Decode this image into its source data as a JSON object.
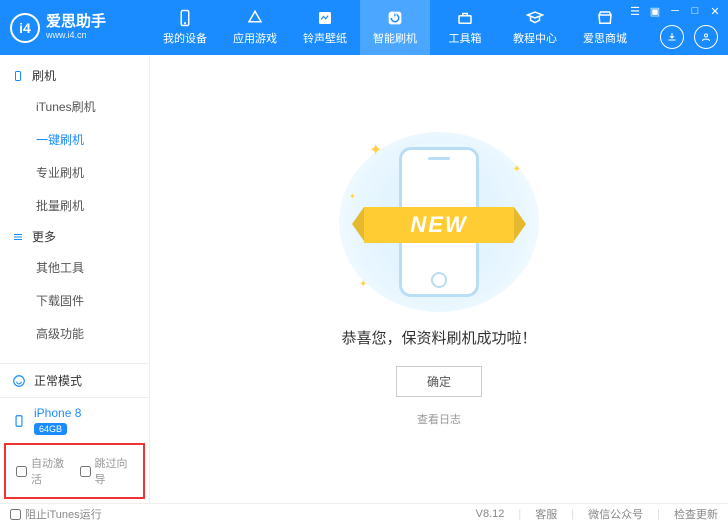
{
  "logo": {
    "badge": "i4",
    "title": "爱思助手",
    "url": "www.i4.cn"
  },
  "nav": [
    {
      "label": "我的设备"
    },
    {
      "label": "应用游戏"
    },
    {
      "label": "铃声壁纸"
    },
    {
      "label": "智能刷机"
    },
    {
      "label": "工具箱"
    },
    {
      "label": "教程中心"
    },
    {
      "label": "爱思商城"
    }
  ],
  "sidebar": {
    "section1": {
      "title": "刷机",
      "items": [
        "iTunes刷机",
        "一键刷机",
        "专业刷机",
        "批量刷机"
      ]
    },
    "section2": {
      "title": "更多",
      "items": [
        "其他工具",
        "下载固件",
        "高级功能"
      ]
    },
    "mode": "正常模式",
    "device": {
      "name": "iPhone 8",
      "storage": "64GB"
    },
    "checks": {
      "auto": "自动激活",
      "skip": "跳过向导"
    }
  },
  "main": {
    "ribbon": "NEW",
    "success": "恭喜您，保资料刷机成功啦！",
    "ok": "确定",
    "log": "查看日志"
  },
  "footer": {
    "block_itunes": "阻止iTunes运行",
    "version": "V8.12",
    "support": "客服",
    "wechat": "微信公众号",
    "update": "检查更新"
  }
}
